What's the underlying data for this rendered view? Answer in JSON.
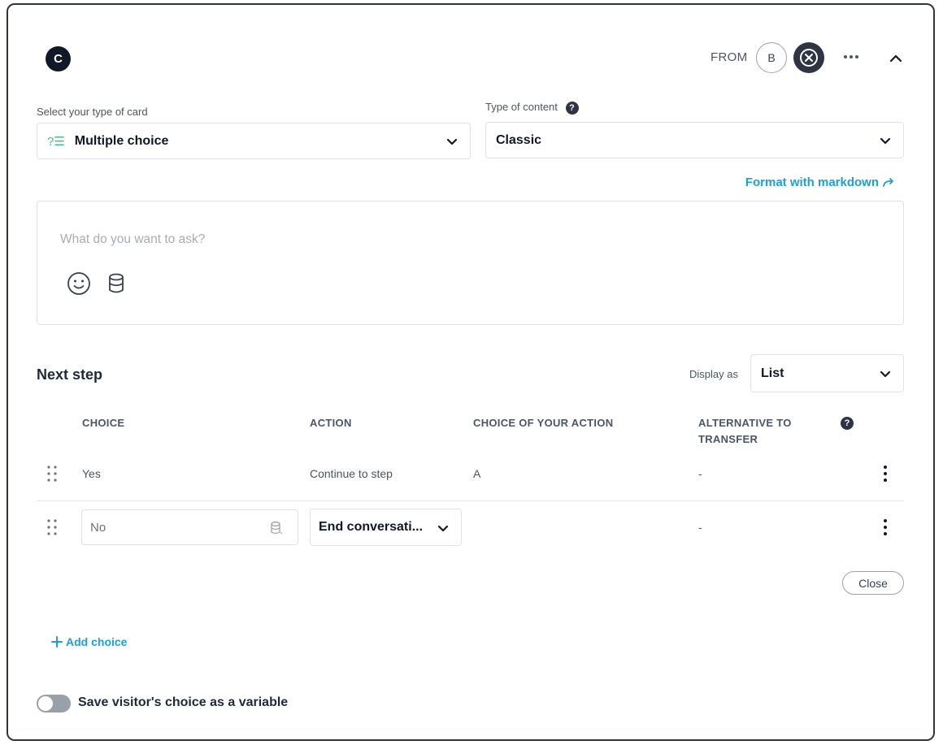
{
  "header": {
    "step_letter": "C",
    "from_label": "FROM",
    "from_step": "B"
  },
  "card_type": {
    "label": "Select your type of card",
    "icon": "multiple-choice-icon",
    "selected": "Multiple choice"
  },
  "content_type": {
    "label": "Type of content",
    "help": "?",
    "selected": "Classic"
  },
  "format_link": "Format with markdown",
  "question": {
    "placeholder": "What do you want to ask?"
  },
  "next_step": {
    "title": "Next step",
    "display_as_label": "Display as",
    "display_as_value": "List",
    "columns": [
      "CHOICE",
      "ACTION",
      "CHOICE OF YOUR ACTION",
      "ALTERNATIVE TO TRANSFER"
    ],
    "column_help": "?",
    "rows": [
      {
        "choice": "Yes",
        "action": "Continue to step",
        "choice_of_action": "A",
        "alternative": "-"
      },
      {
        "choice": "No",
        "action": "End conversati...",
        "choice_of_action": "",
        "alternative": "-"
      }
    ],
    "close_label": "Close"
  },
  "add_choice_label": "Add choice",
  "save_variable_label": "Save visitor's choice as a variable",
  "colors": {
    "accent": "#1a9fe0",
    "dark": "#2f3442",
    "choice_icon": "#3cc480"
  }
}
